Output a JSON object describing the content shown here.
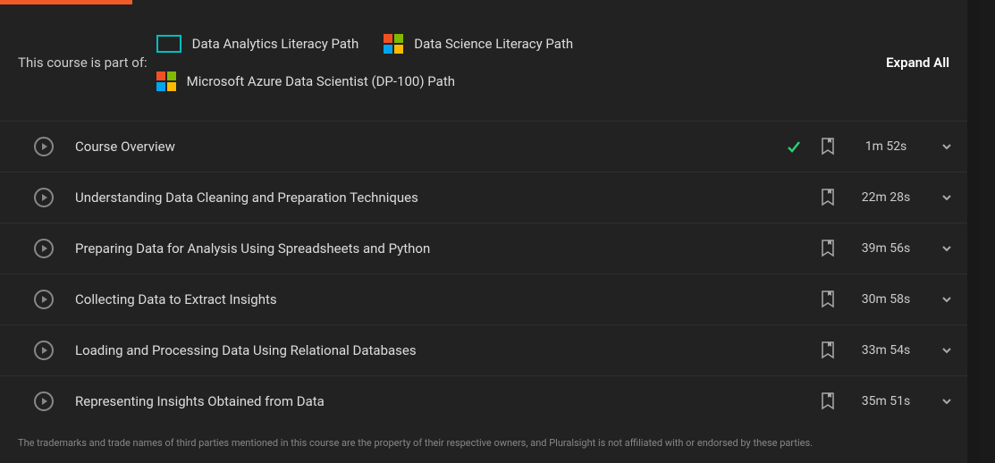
{
  "paths_label": "This course is part of:",
  "paths": [
    {
      "label": "Data Analytics Literacy Path",
      "icon": "box"
    },
    {
      "label": "Data Science Literacy Path",
      "icon": "ms"
    },
    {
      "label": "Microsoft Azure Data Scientist (DP-100) Path",
      "icon": "ms"
    }
  ],
  "expand_all": "Expand All",
  "modules": [
    {
      "title": "Course Overview",
      "duration": "1m 52s",
      "completed": true
    },
    {
      "title": "Understanding Data Cleaning and Preparation Techniques",
      "duration": "22m 28s",
      "completed": false
    },
    {
      "title": "Preparing Data for Analysis Using Spreadsheets and Python",
      "duration": "39m 56s",
      "completed": false
    },
    {
      "title": "Collecting Data to Extract Insights",
      "duration": "30m 58s",
      "completed": false
    },
    {
      "title": "Loading and Processing Data Using Relational Databases",
      "duration": "33m 54s",
      "completed": false
    },
    {
      "title": "Representing Insights Obtained from Data",
      "duration": "35m 51s",
      "completed": false
    }
  ],
  "disclaimer": "The trademarks and trade names of third parties mentioned in this course are the property of their respective owners, and Pluralsight is not affiliated with or endorsed by these parties."
}
